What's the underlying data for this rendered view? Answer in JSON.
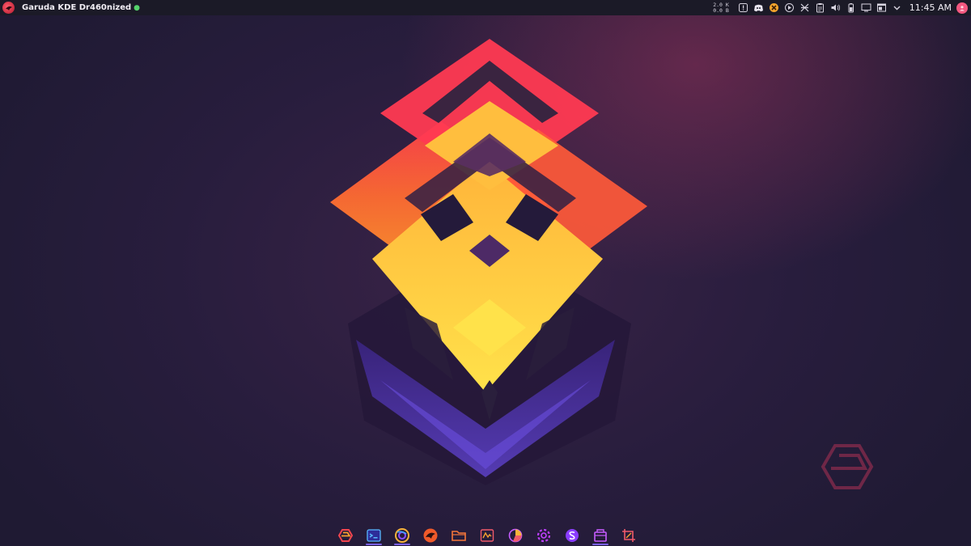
{
  "panel": {
    "window_title": "Garuda KDE Dr460nized",
    "netspeed_up": "2.0 K",
    "netspeed_down": "0.0 B",
    "clock": "11:45 AM"
  },
  "tray_icons": [
    "notification-icon",
    "discord-icon",
    "crossover-icon",
    "media-player-icon",
    "kde-connect-icon",
    "clipboard-icon",
    "volume-icon",
    "battery-icon",
    "display-icon",
    "window-icon",
    "expand-tray-icon"
  ],
  "dock": {
    "items": [
      {
        "name": "garuda-welcome",
        "active": false
      },
      {
        "name": "terminal",
        "active": true
      },
      {
        "name": "browser",
        "active": true
      },
      {
        "name": "garuda-assistant",
        "active": false
      },
      {
        "name": "file-manager",
        "active": false
      },
      {
        "name": "system-monitor",
        "active": false
      },
      {
        "name": "disk-usage",
        "active": false
      },
      {
        "name": "settings",
        "active": false
      },
      {
        "name": "software-store",
        "active": false
      },
      {
        "name": "package-manager",
        "active": true
      },
      {
        "name": "screenshot-tool",
        "active": false
      }
    ]
  },
  "colors": {
    "panel_bg": "#1b1a27",
    "accent": "#7c62e8",
    "wallpaper_orange": "#ff5a3c",
    "wallpaper_yellow": "#ffd13a",
    "wallpaper_purple": "#4a2fa0"
  }
}
